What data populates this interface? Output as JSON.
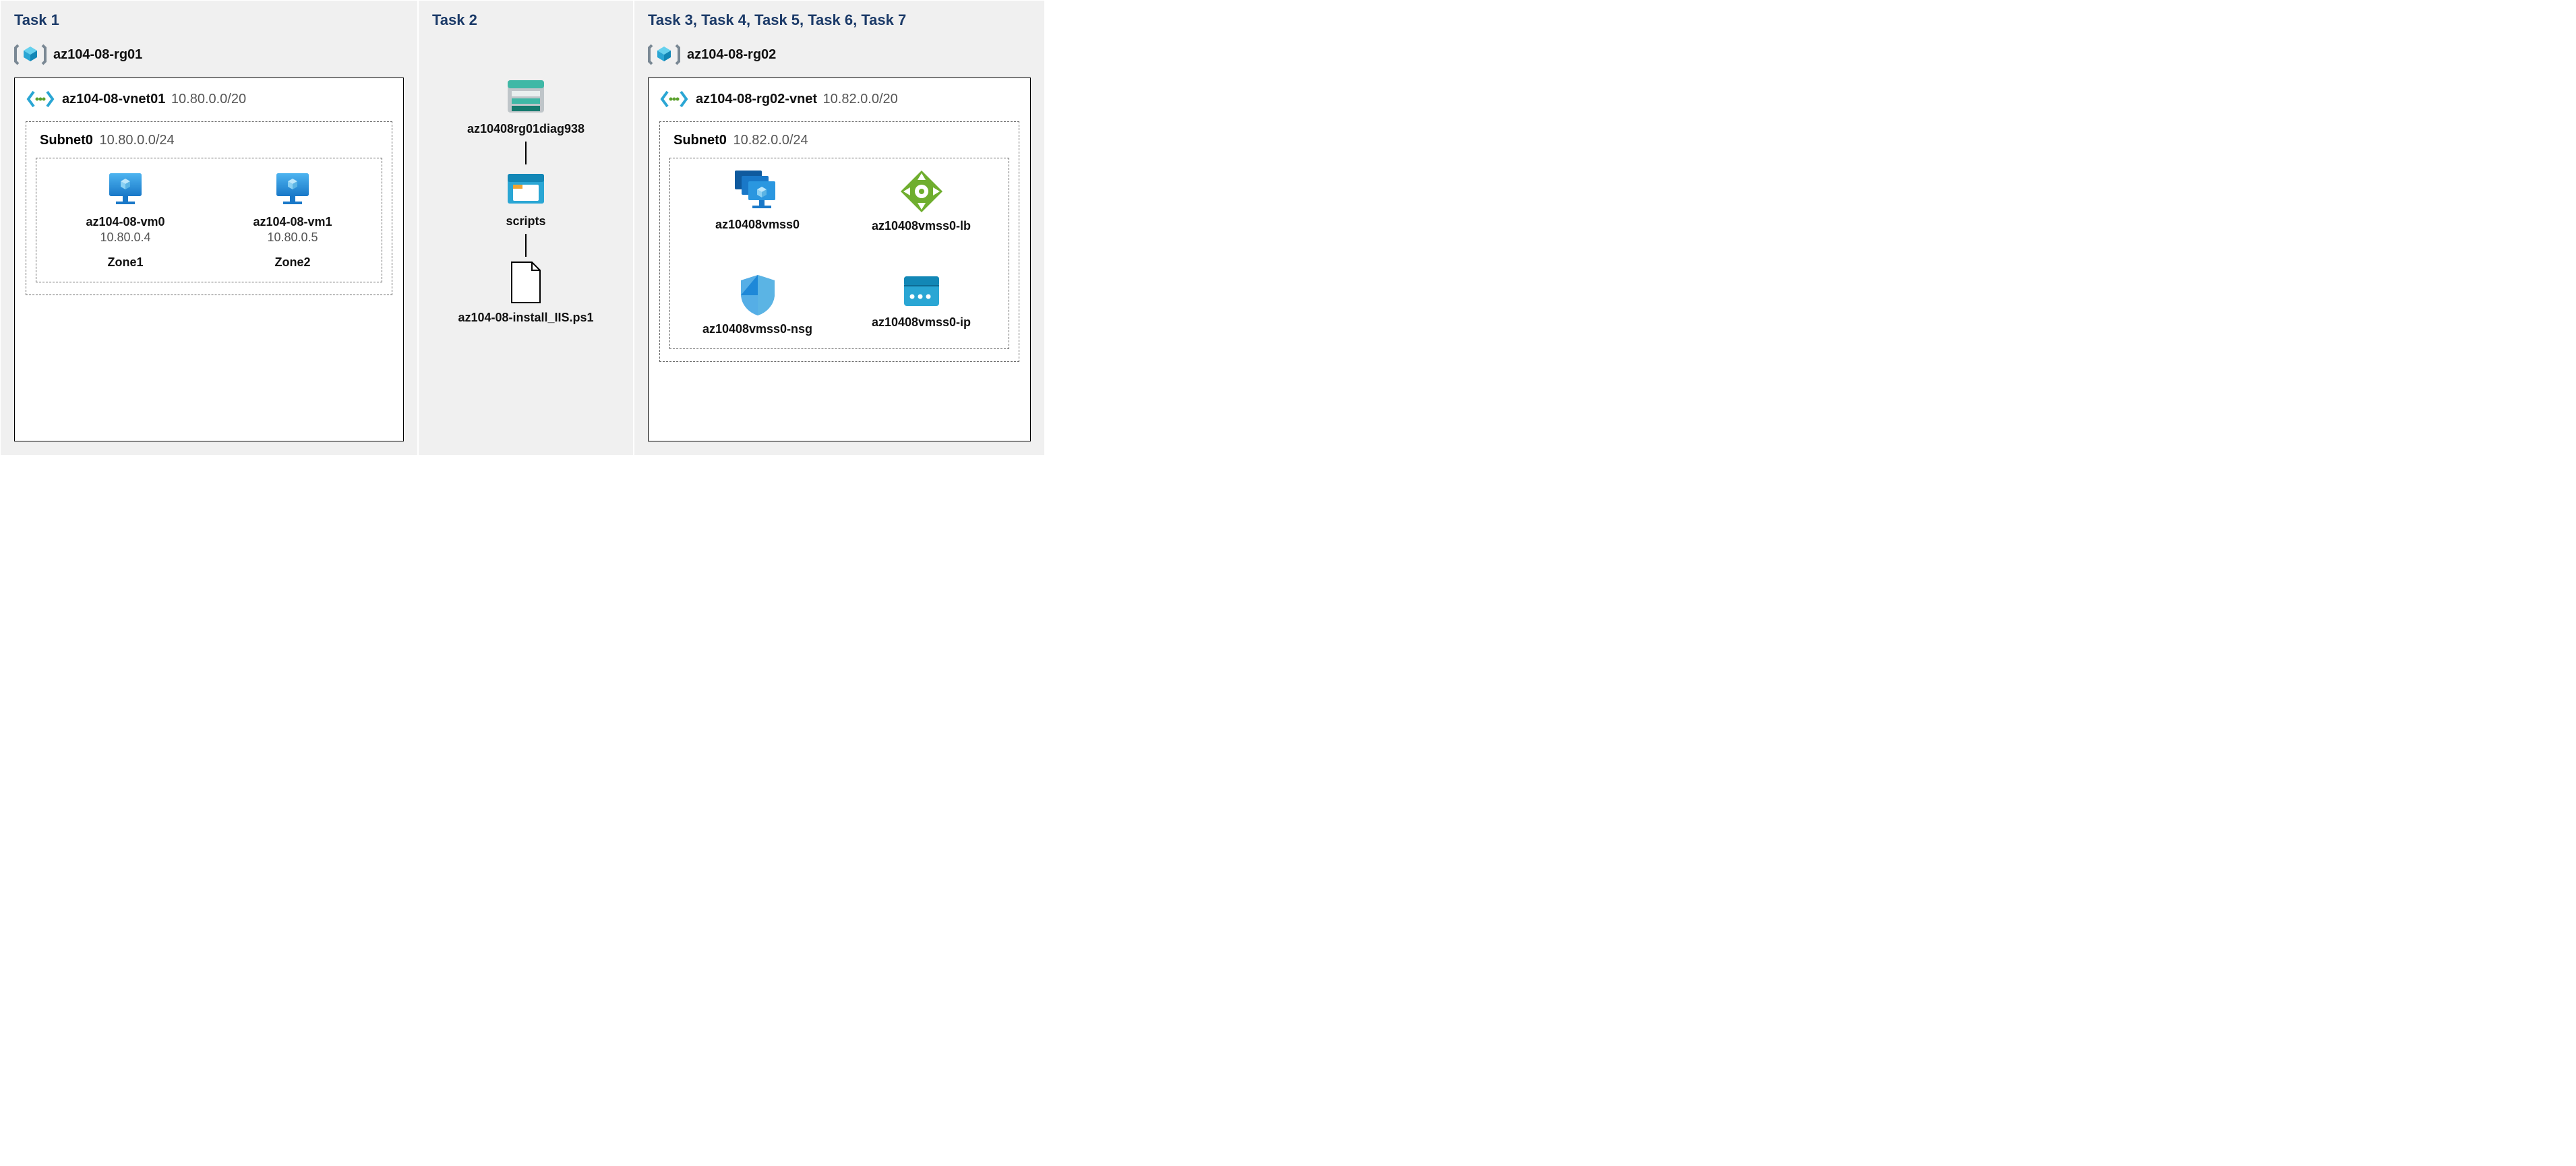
{
  "task1": {
    "title": "Task 1",
    "rg": "az104-08-rg01",
    "vnet": {
      "name": "az104-08-vnet01",
      "cidr": "10.80.0.0/20"
    },
    "subnet": {
      "name": "Subnet0",
      "cidr": "10.80.0.0/24"
    },
    "vm0": {
      "name": "az104-08-vm0",
      "ip": "10.80.0.4",
      "zone": "Zone1"
    },
    "vm1": {
      "name": "az104-08-vm1",
      "ip": "10.80.0.5",
      "zone": "Zone2"
    }
  },
  "task2": {
    "title": "Task 2",
    "storage": "az10408rg01diag938",
    "container": "scripts",
    "file": "az104-08-install_IIS.ps1"
  },
  "task3": {
    "title": "Task 3, Task 4, Task 5, Task 6, Task 7",
    "rg": "az104-08-rg02",
    "vnet": {
      "name": "az104-08-rg02-vnet",
      "cidr": "10.82.0.0/20"
    },
    "subnet": {
      "name": "Subnet0",
      "cidr": "10.82.0.0/24"
    },
    "vmss": "az10408vmss0",
    "lb": "az10408vmss0-lb",
    "nsg": "az10408vmss0-nsg",
    "ip": "az10408vmss0-ip"
  }
}
